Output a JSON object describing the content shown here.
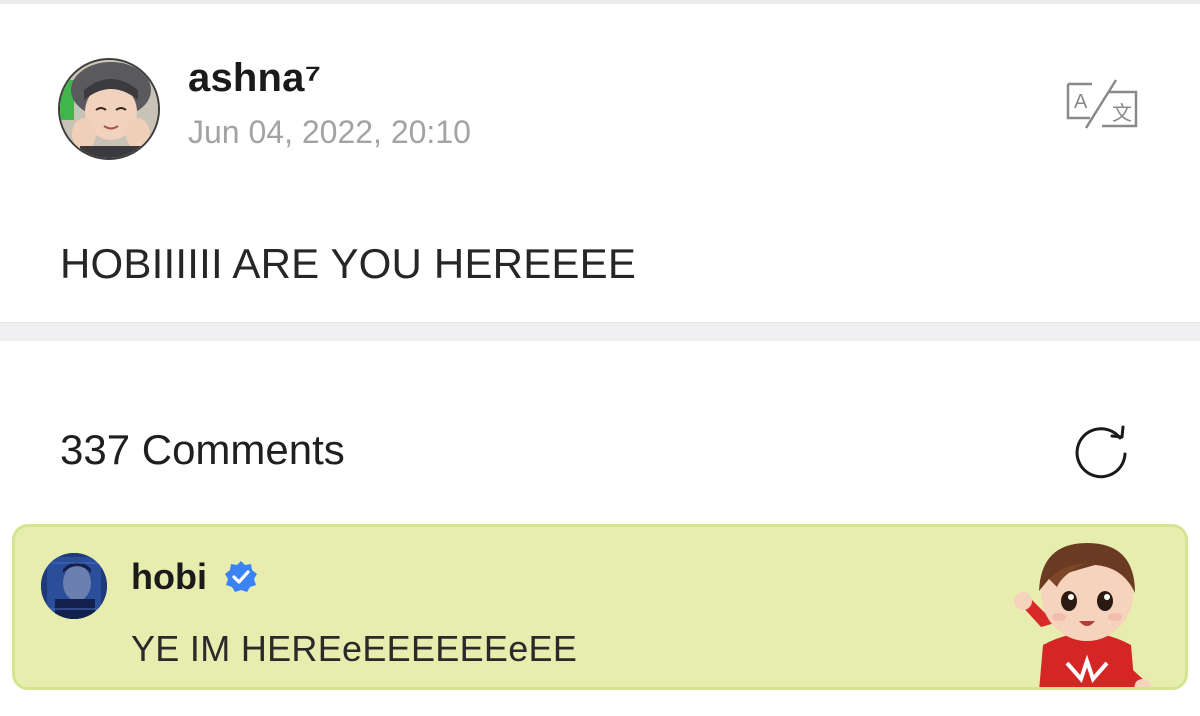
{
  "post": {
    "author": "ashna⁷",
    "date": "Jun 04, 2022, 20:10",
    "body": "HOBIIIIII ARE YOU HEREEEE"
  },
  "comments": {
    "count_label": "337 Comments",
    "highlighted": {
      "author": "hobi",
      "text": "YE IM HEREeEEEEEEeEE",
      "verified": true
    }
  },
  "icons": {
    "translate": "translate-icon",
    "refresh": "refresh-icon",
    "verified": "verified-badge-icon"
  },
  "colors": {
    "highlight_bg": "#e6edae",
    "highlight_border": "#d4e591",
    "verified_blue": "#3b82f6",
    "meta_gray": "#a3a3a3"
  }
}
